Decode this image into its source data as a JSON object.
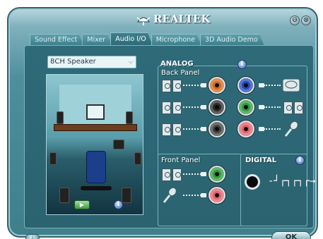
{
  "app": {
    "brand": "REALTEK",
    "window_buttons": {
      "minimize": "⊖",
      "close": "⊗"
    }
  },
  "tabs": [
    {
      "label": "Sound Effect"
    },
    {
      "label": "Mixer"
    },
    {
      "label": "Audio I/O",
      "active": true
    },
    {
      "label": "Microphone"
    },
    {
      "label": "3D Audio Demo"
    }
  ],
  "speaker_config": {
    "selected": "8CH Speaker",
    "arrow": "⌵"
  },
  "room_preview": {
    "play_label": "▶",
    "info": "i"
  },
  "analog": {
    "title": "ANALOG",
    "info": "i",
    "back_panel_label": "Back Panel",
    "front_panel_label": "Front Panel",
    "back_jacks": [
      {
        "device": "speakers",
        "color": "#d2691e"
      },
      {
        "device": "speakers",
        "color": "#2a2a2a"
      },
      {
        "device": "speakers",
        "color": "#404040"
      },
      {
        "device": "line-in",
        "color": "#2448b8"
      },
      {
        "device": "speakers",
        "color": "#2f9a3a"
      },
      {
        "device": "microphone",
        "color": "#e0606a"
      }
    ],
    "front_jacks": [
      {
        "device": "speakers",
        "color": "#2f9a3a"
      },
      {
        "device": "microphone",
        "color": "#e0606a"
      }
    ]
  },
  "digital": {
    "title": "DIGITAL",
    "info": "i",
    "signal": "-┘┌┐┌┐┌→"
  },
  "footer": {
    "info_label": "i",
    "ok_label": "OK"
  }
}
